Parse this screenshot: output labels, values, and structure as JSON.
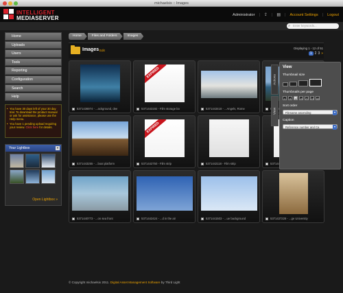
{
  "window": {
    "title": "michaelsix :: Images"
  },
  "header": {
    "logo_line1": "INTELLIGENT",
    "logo_line2": "MEDIASERVER",
    "user": "Administrator",
    "account_settings": "Account Settings",
    "logout": "Logout",
    "search_placeholder": "Enter keywords..."
  },
  "nav": {
    "items": [
      "Home",
      "Uploads",
      "Users",
      "Tools",
      "Reporting",
      "Configuration",
      "Search",
      "Help"
    ]
  },
  "notice": {
    "trial_text": "You have 30 days left of your 30 day trial. To download the product manual or ask for assistance, please use the Help menu.",
    "upload_text_1": "You have 1 pending upload requiring your review. ",
    "upload_link": "Click here",
    "upload_text_2": " for details."
  },
  "lightbox": {
    "title": "Your Lightbox",
    "open_label": "Open Lightbox »",
    "thumbs": [
      {
        "top": "#6c7fa3",
        "bottom": "#c2b9a1"
      },
      {
        "top": "#2f5f8a",
        "bottom": "#1b2a3a"
      },
      {
        "top": "#304a6d",
        "bottom": "#e8eef4"
      },
      {
        "top": "#8aa7c9",
        "bottom": "#3a5226"
      },
      {
        "top": "#1f3a5a",
        "bottom": "#8fb3d8"
      },
      {
        "top": "#6fa0cf",
        "bottom": "#d8e4ef"
      }
    ]
  },
  "breadcrumb": [
    "Home",
    "Files and Folders",
    "Images"
  ],
  "main": {
    "title": "Images",
    "edit_label": "Edit",
    "display_text": "Displaying 1 - 12 of 51",
    "pages": [
      "1",
      "2",
      "3",
      "»"
    ]
  },
  "images": [
    {
      "caption": "5371436974 - ...ackground, dee",
      "bg": "linear-gradient(#0f2d4d, #3f80a6 60%, #0a2238)",
      "shape": "wide-none",
      "expired": false
    },
    {
      "caption": "5371443192 - Film storage bo",
      "bg": "linear-gradient(#ffffff, #ececec)",
      "shape": "sq",
      "expired": true,
      "expired_text": "EXPIRED"
    },
    {
      "caption": "5371443418 - ...Angels, Rome",
      "bg": "linear-gradient(#a3c3e8, #e3e3df 55%, #6d7a7e)",
      "shape": "wide",
      "expired": false
    },
    {
      "caption": "5371443326 - ...ion coastline",
      "bg": "linear-gradient(#7aa3cf, #8bb0d4 45%, #2f5e7f 60%, #2b3a2a)",
      "shape": "mid",
      "expired": false
    },
    {
      "caption": "5371443255 - ...boat platform",
      "bg": "linear-gradient(#77a5d8, #c8ddef 48%, #7e5a34 52%, #3b2613)",
      "shape": "mid",
      "expired": false
    },
    {
      "caption": "5371442750 - Film strip",
      "bg": "linear-gradient(#ffffff, #f3f3f3)",
      "shape": "sq",
      "expired": true,
      "expired_text": "EXPIRED"
    },
    {
      "caption": "5371442118 - Film strip",
      "bg": "linear-gradient(#f6f6f6, #e0e0e0)",
      "shape": "sq",
      "expired": false
    },
    {
      "caption": "5371441892 - ...te background",
      "bg": "linear-gradient(#fafafa, #ececec)",
      "shape": "sq",
      "expired": false
    },
    {
      "caption": "5371440773 - ...on sea front",
      "bg": "linear-gradient(#6fa3c8, #a8c7db 50%, #8a9aa4)",
      "shape": "mid",
      "expired": false
    },
    {
      "caption": "5371442424 - ...d in the air",
      "bg": "linear-gradient(#2f63b4, #7ea4d6)",
      "shape": "mid",
      "expired": false
    },
    {
      "caption": "5371441503 - ...ue background",
      "bg": "linear-gradient(#9cc0ea, #dbe8f6)",
      "shape": "mid",
      "expired": false
    },
    {
      "caption": "5371437228 - ...ge University",
      "bg": "linear-gradient(#d9c39c, #8c6a3e)",
      "shape": "tall",
      "expired": false
    }
  ],
  "panel": {
    "tab_actions": "Actions",
    "tab_view": "View",
    "title": "View",
    "thumb_size_label": "Thumbnail size",
    "per_page_label": "Thumbnails per page",
    "per_page_options": [
      "4",
      "8",
      "12",
      "16",
      "20",
      "24",
      "48"
    ],
    "sort_label": "Sort order",
    "sort_value": "Filename ascending",
    "caption_label": "Caption",
    "caption_value": "Reference number and Ca"
  },
  "footer": {
    "copyright": "© Copyright michaelsix 2011. ",
    "link": "Digital Asset Management Software",
    "by": " by Third Light"
  }
}
